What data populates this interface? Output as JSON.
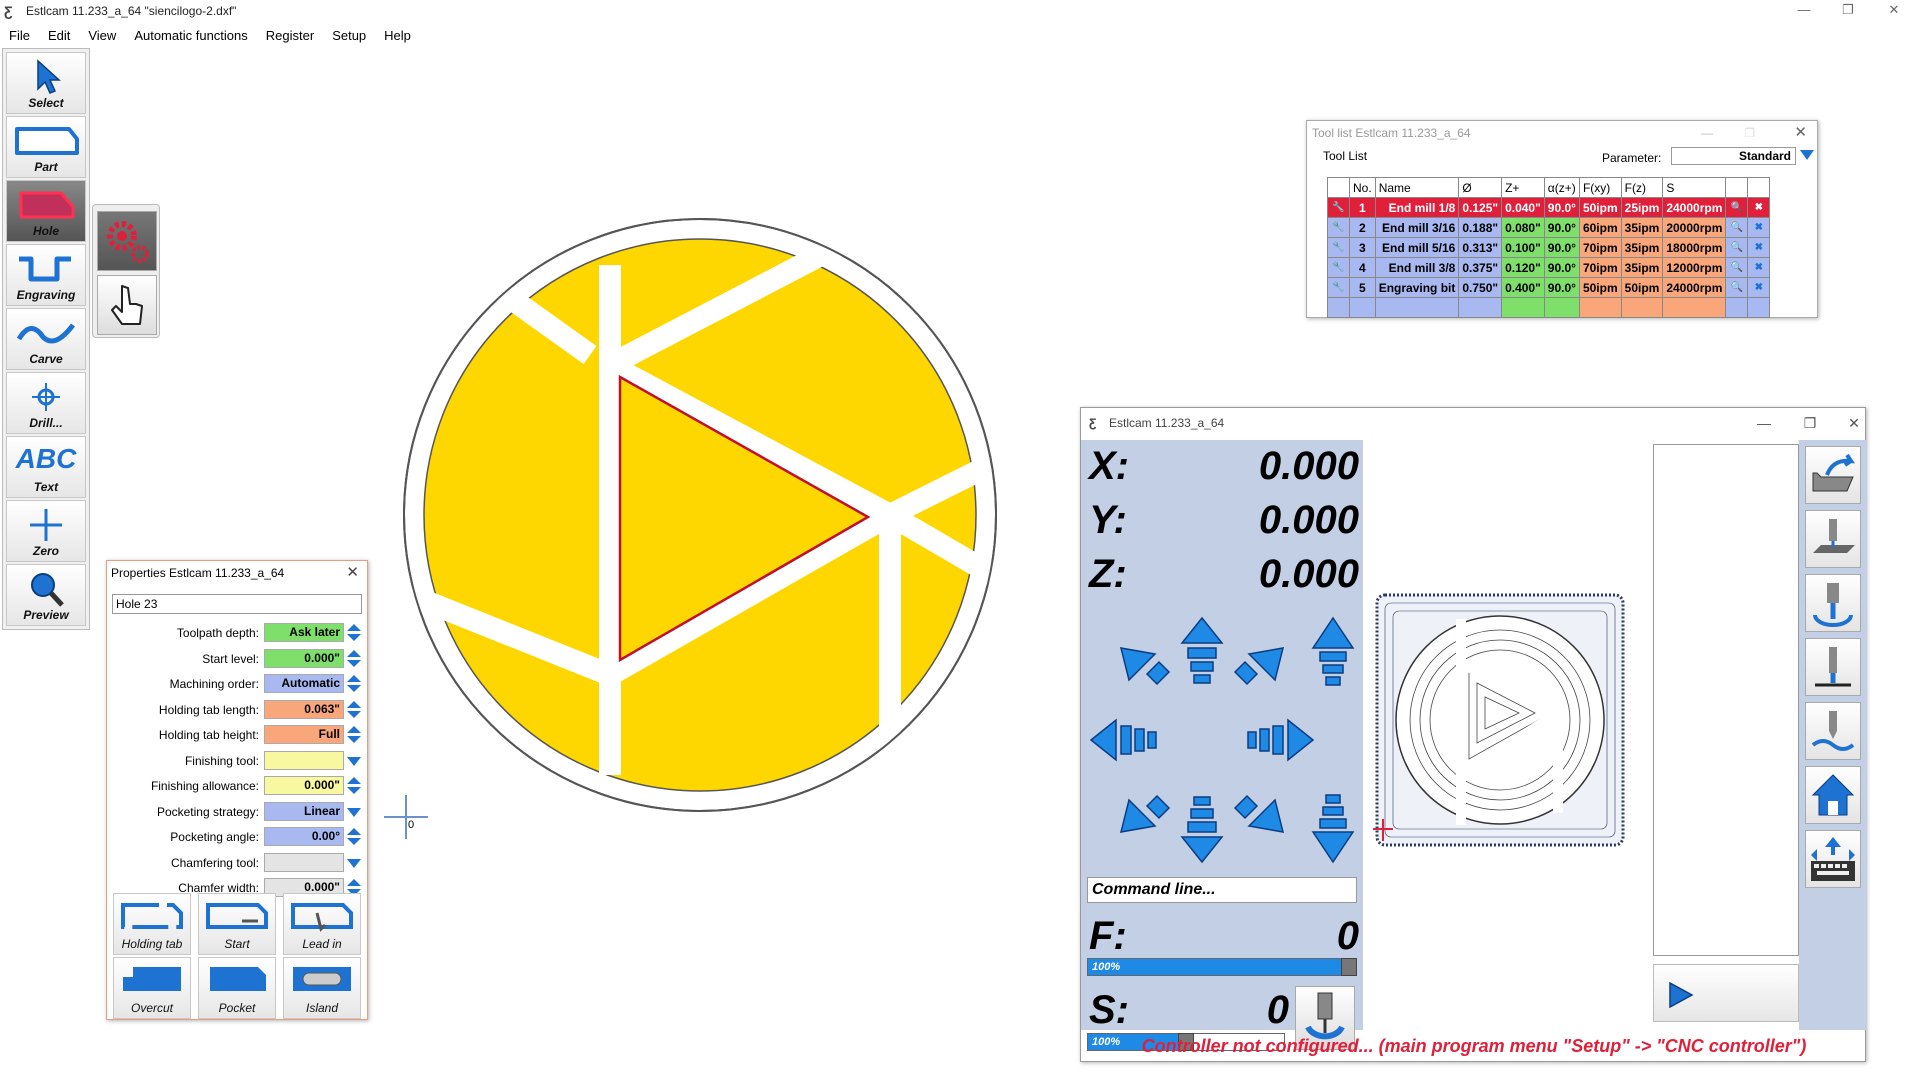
{
  "window": {
    "title": "Estlcam 11.233_a_64 \"siencilogo-2.dxf\"",
    "controls": [
      "—",
      "❐",
      "✕"
    ]
  },
  "menu": [
    "File",
    "Edit",
    "View",
    "Automatic functions",
    "Register",
    "Setup",
    "Help"
  ],
  "toolbar": {
    "select": "Select",
    "part": "Part",
    "hole": "Hole",
    "engraving": "Engraving",
    "carve": "Carve",
    "drill": "Drill...",
    "text": "Text",
    "zero": "Zero",
    "preview": "Preview",
    "text_icon": "ABC"
  },
  "canvas": {
    "origin_label": "0",
    "colors": {
      "fill": "#ffd700",
      "cut": "#ffffff",
      "outline": "#555555",
      "selected": "#c0102a"
    }
  },
  "tool_list": {
    "title": "Tool list Estlcam 11.233_a_64",
    "heading": "Tool List",
    "parameter_label": "Parameter:",
    "parameter_value": "Standard",
    "columns": [
      "No.",
      "Name",
      "Ø",
      "Z+",
      "α(z+)",
      "F(xy)",
      "F(z)",
      "S"
    ],
    "rows": [
      {
        "no": "1",
        "name": "End mill 1/8",
        "dia": "0.125\"",
        "z": "0.040\"",
        "ang": "90.0°",
        "fxy": "50ipm",
        "fz": "25ipm",
        "s": "24000rpm"
      },
      {
        "no": "2",
        "name": "End mill 3/16",
        "dia": "0.188\"",
        "z": "0.080\"",
        "ang": "90.0°",
        "fxy": "60ipm",
        "fz": "35ipm",
        "s": "20000rpm"
      },
      {
        "no": "3",
        "name": "End mill 5/16",
        "dia": "0.313\"",
        "z": "0.100\"",
        "ang": "90.0°",
        "fxy": "70ipm",
        "fz": "35ipm",
        "s": "18000rpm"
      },
      {
        "no": "4",
        "name": "End mill 3/8",
        "dia": "0.375\"",
        "z": "0.120\"",
        "ang": "90.0°",
        "fxy": "70ipm",
        "fz": "35ipm",
        "s": "12000rpm"
      },
      {
        "no": "5",
        "name": "Engraving bit",
        "dia": "0.750\"",
        "z": "0.400\"",
        "ang": "90.0°",
        "fxy": "50ipm",
        "fz": "50ipm",
        "s": "24000rpm"
      }
    ]
  },
  "properties": {
    "title": "Properties Estlcam 11.233_a_64",
    "name": "Hole 23",
    "rows": [
      {
        "label": "Toolpath depth:",
        "value": "Ask later",
        "color": "#7ee06a",
        "ctrl": "spin"
      },
      {
        "label": "Start level:",
        "value": "0.000\"",
        "color": "#7ee06a",
        "ctrl": "spin"
      },
      {
        "label": "Machining order:",
        "value": "Automatic",
        "color": "#a8b8f0",
        "ctrl": "spin"
      },
      {
        "label": "Holding tab length:",
        "value": "0.063\"",
        "color": "#f9a67a",
        "ctrl": "spin"
      },
      {
        "label": "Holding tab height:",
        "value": "Full",
        "color": "#f9a67a",
        "ctrl": "spin"
      },
      {
        "label": "Finishing tool:",
        "value": "",
        "color": "#f8f8a0",
        "ctrl": "drop"
      },
      {
        "label": "Finishing allowance:",
        "value": "0.000\"",
        "color": "#f8f8a0",
        "ctrl": "spin"
      },
      {
        "label": "Pocketing strategy:",
        "value": "Linear",
        "color": "#a8b8f0",
        "ctrl": "drop"
      },
      {
        "label": "Pocketing angle:",
        "value": "0.00°",
        "color": "#a8b8f0",
        "ctrl": "spin"
      },
      {
        "label": "Chamfering tool:",
        "value": "",
        "color": "#e4e4e4",
        "ctrl": "drop"
      },
      {
        "label": "Chamfer width:",
        "value": "0.000\"",
        "color": "#e4e4e4",
        "ctrl": "spin"
      }
    ],
    "buttons": {
      "holding_tab": "Holding tab",
      "start": "Start",
      "lead_in": "Lead in",
      "overcut": "Overcut",
      "pocket": "Pocket",
      "island": "Island"
    }
  },
  "controller": {
    "title": "Estlcam 11.233_a_64",
    "x_label": "X:",
    "x": "0.000",
    "y_label": "Y:",
    "y": "0.000",
    "z_label": "Z:",
    "z": "0.000",
    "command_placeholder": "Command line...",
    "f_label": "F:",
    "f": "0",
    "f_override": "100%",
    "f_fill": 0.95,
    "s_label": "S:",
    "s": "0",
    "s_override": "100%",
    "s_fill": 0.5,
    "message": "Controller not configured... (main program menu \"Setup\" -> \"CNC controller\")"
  }
}
